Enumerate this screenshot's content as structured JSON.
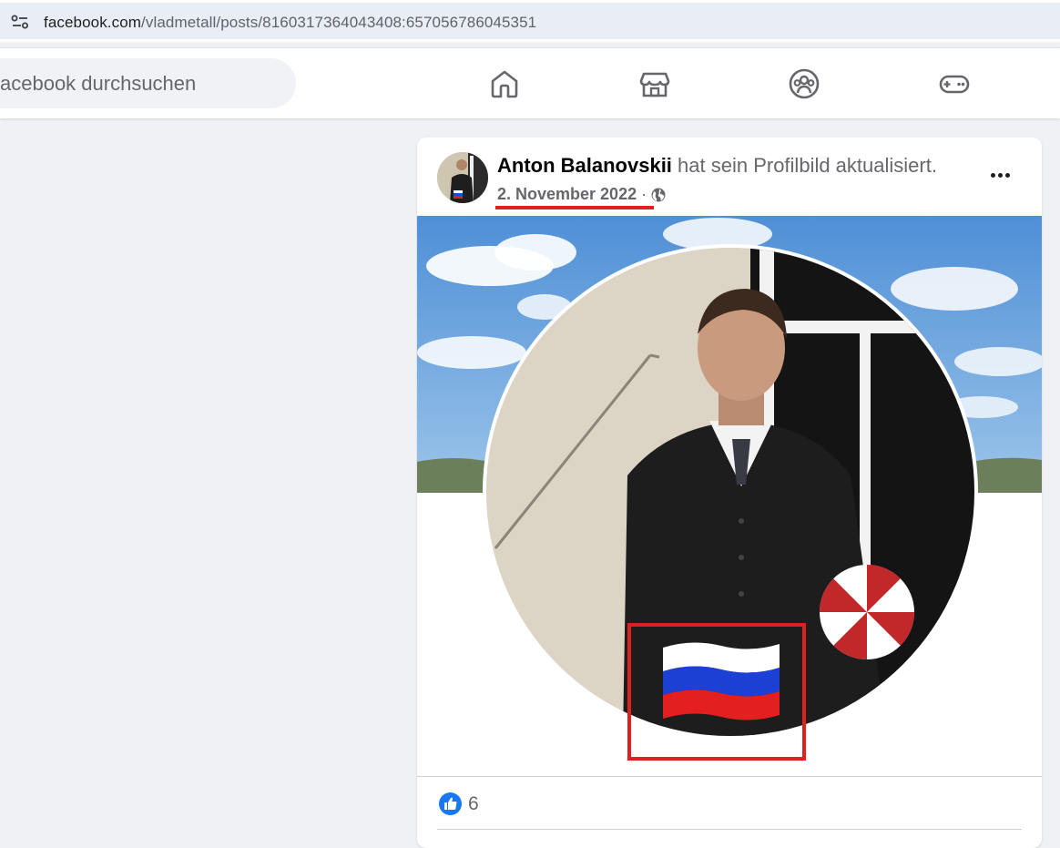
{
  "browser": {
    "url_host": "facebook.com",
    "url_path": "/vladmetall/posts/8160317364043408:657056786045351"
  },
  "header": {
    "search_placeholder": "acebook durchsuchen",
    "nav_icons": [
      "home-icon",
      "marketplace-icon",
      "groups-icon",
      "gaming-icon"
    ]
  },
  "post": {
    "author": "Anton Balanovskii",
    "action": " hat sein Profilbild aktualisiert.",
    "date": "2. November 2022",
    "separator": "·",
    "audience_icon": "globe-icon",
    "reaction_icon": "like-icon",
    "like_count": "6",
    "annotation_color": "#e0201f"
  }
}
